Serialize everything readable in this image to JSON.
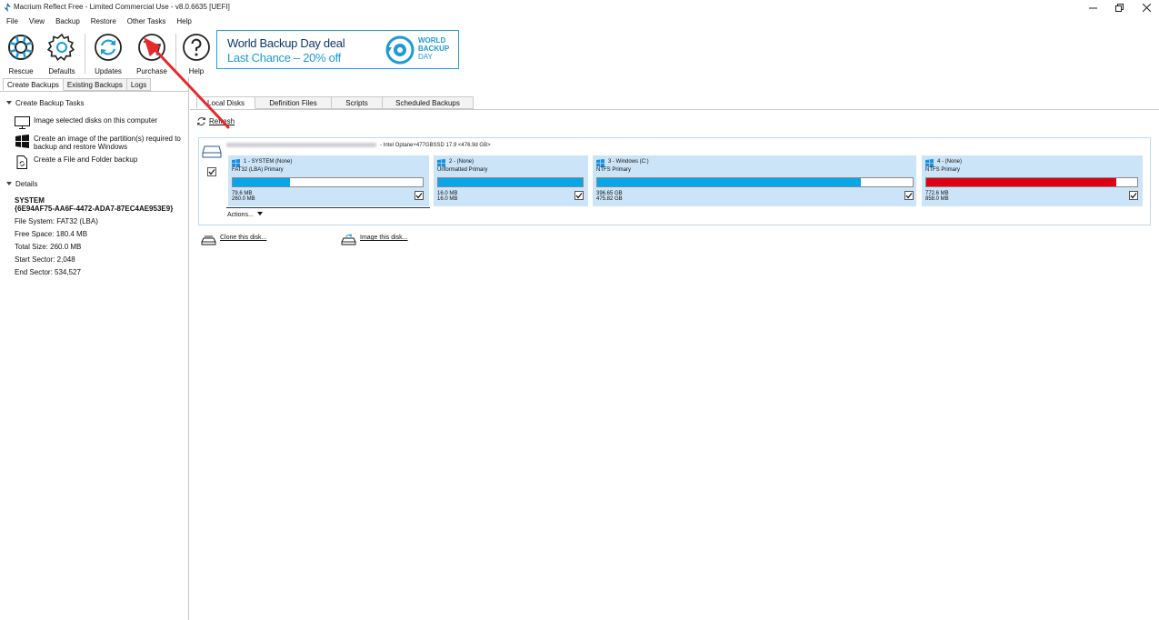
{
  "window": {
    "title": "Macrium Reflect Free - Limited Commercial Use - v8.0.6635  [UEFI]"
  },
  "menu": [
    "File",
    "View",
    "Backup",
    "Restore",
    "Other Tasks",
    "Help"
  ],
  "toolbar": {
    "rescue": "Rescue",
    "defaults": "Defaults",
    "updates": "Updates",
    "purchase": "Purchase",
    "help": "Help"
  },
  "promo": {
    "line1": "World Backup Day deal",
    "line2": "Last Chance – 20% off",
    "badge_line1": "WORLD",
    "badge_line2": "BACKUP",
    "badge_line3": "DAY"
  },
  "left_tabs": [
    "Create Backups",
    "Existing Backups",
    "Logs"
  ],
  "backup_tasks": {
    "header": "Create Backup Tasks",
    "items": [
      "Image selected disks on this computer",
      "Create an image of the partition(s) required to backup and restore Windows",
      "Create a File and Folder backup"
    ]
  },
  "details": {
    "header": "Details",
    "name": "SYSTEM",
    "guid": "{6E94AF75-AA6F-4472-ADA7-87EC4AE953E9}",
    "file_system": "File System:  FAT32 (LBA)",
    "free_space": "Free Space:   180.4 MB",
    "total_size": "Total Size:    260.0 MB",
    "start_sector": "Start Sector:   2,048",
    "end_sector": "End Sector:    534,527"
  },
  "main_tabs": [
    "Local Disks",
    "Definition Files",
    "Scripts",
    "Scheduled Backups"
  ],
  "refresh_label": "Refresh",
  "disk": {
    "title_suffix": "- Intel Optane+477GBSSD 17.9  <476.9d GB>",
    "partitions": [
      {
        "name": "1 - SYSTEM (None)",
        "type": "FAT32 (LBA) Primary",
        "used": "79.6 MB",
        "total": "260.0 MB",
        "fill": 0.3,
        "color": "#08a5e8"
      },
      {
        "name": "2 -  (None)",
        "type": "Unformatted Primary",
        "used": "16.0 MB",
        "total": "16.0 MB",
        "fill": 1.0,
        "color": "#08a5e8"
      },
      {
        "name": "3 - Windows (C:)",
        "type": "NTFS Primary",
        "used": "396.65 GB",
        "total": "475.82 GB",
        "fill": 0.835,
        "color": "#08a5e8"
      },
      {
        "name": "4 -  (None)",
        "type": "NTFS Primary",
        "used": "772.6 MB",
        "total": "858.0 MB",
        "fill": 0.9,
        "color": "#dc0014"
      }
    ],
    "actions_label": "Actions..."
  },
  "links": {
    "clone": "Clone this disk...",
    "image": "Image this disk..."
  }
}
